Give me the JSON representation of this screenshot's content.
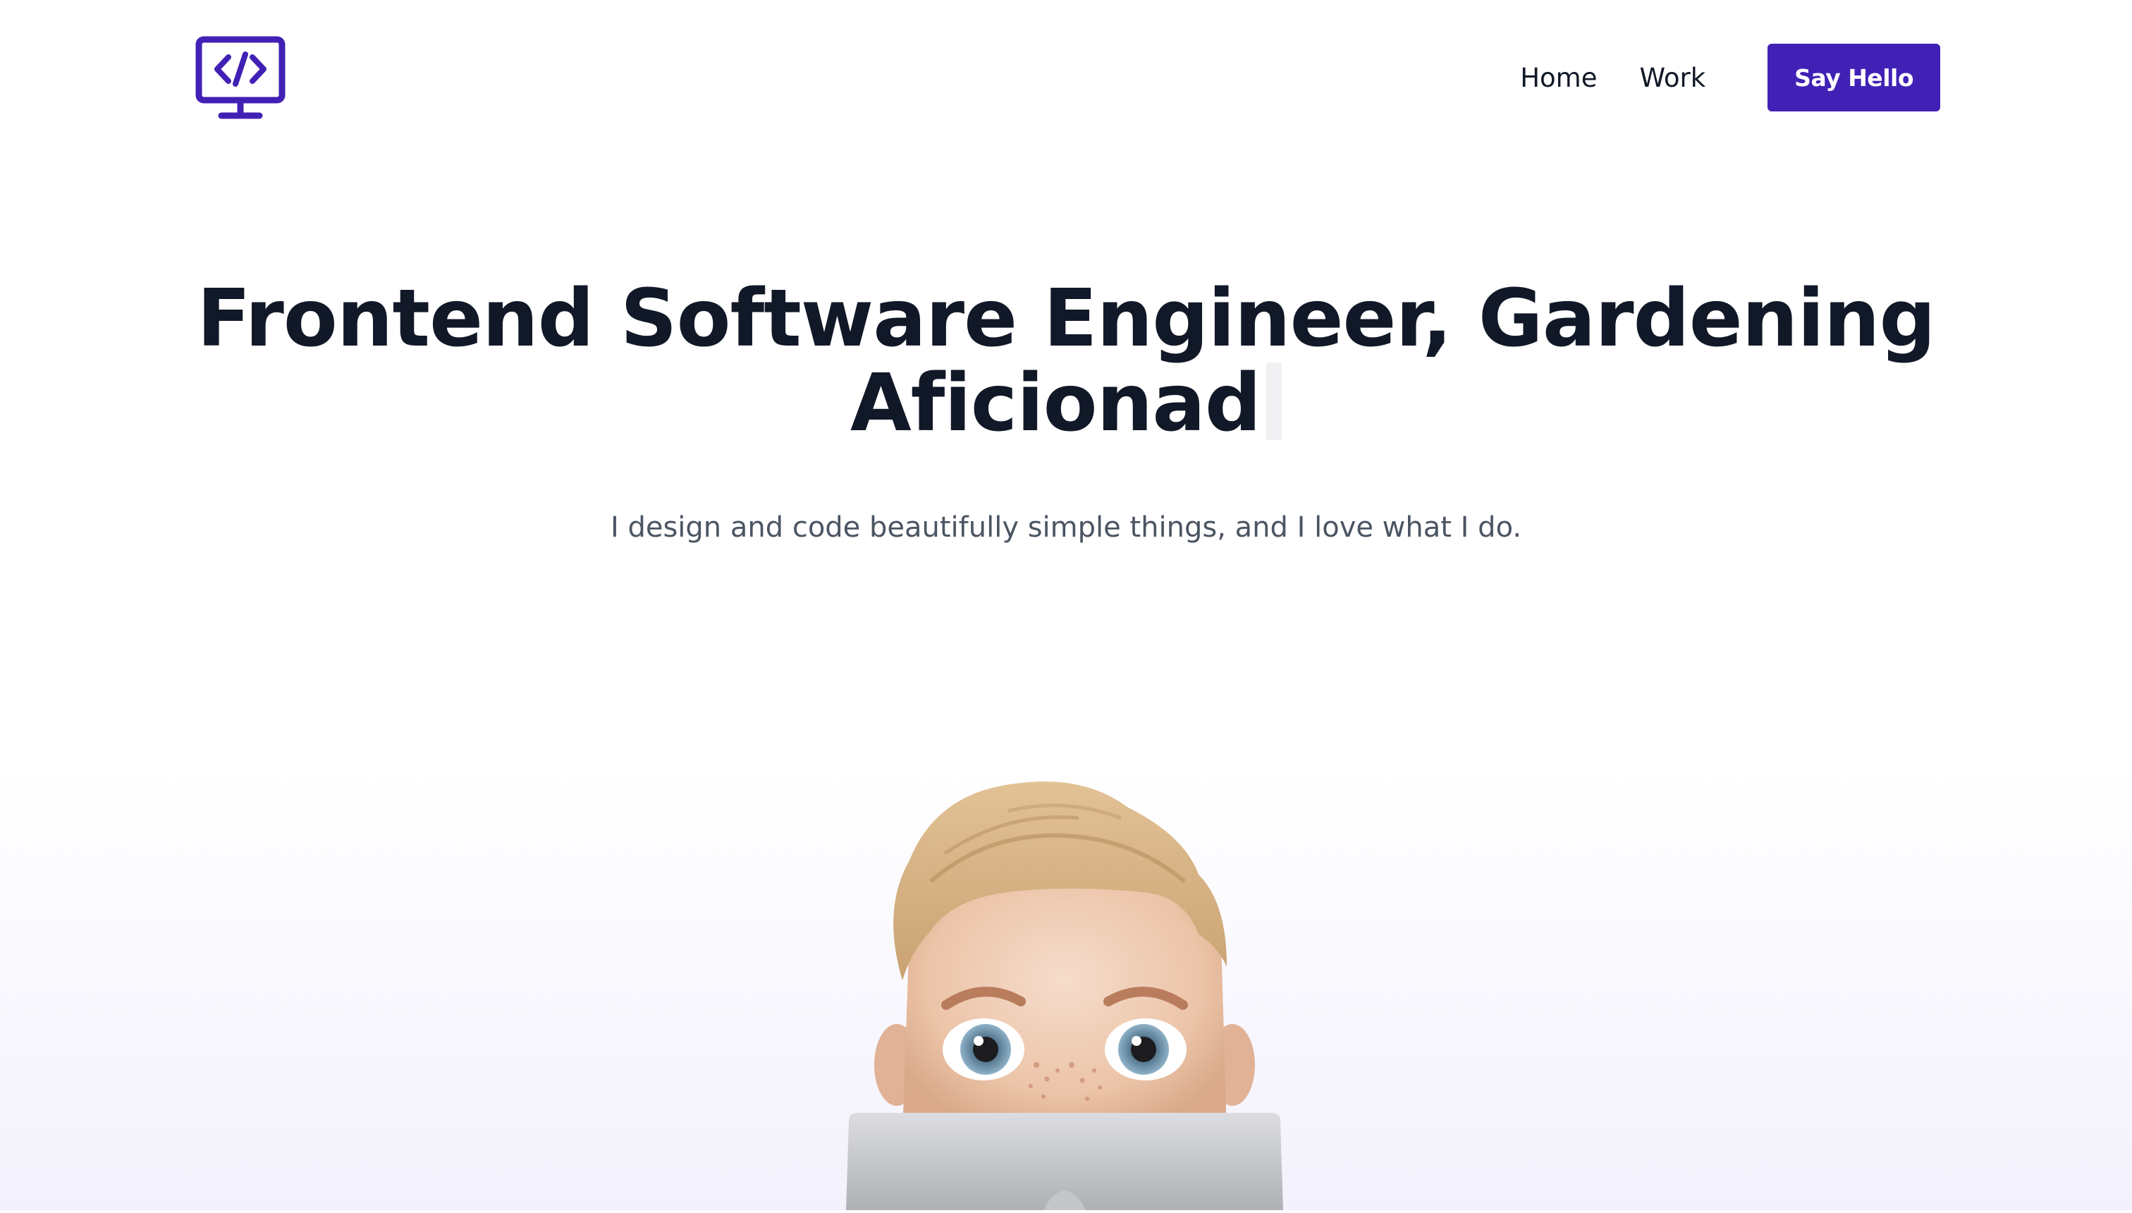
{
  "header": {
    "logo_icon": "monitor-code-icon",
    "nav": [
      {
        "label": "Home"
      },
      {
        "label": "Work"
      }
    ],
    "cta_label": "Say Hello"
  },
  "hero": {
    "title_line1": "Frontend Software Engineer, Gardening",
    "title_line2": "Aficionad",
    "subtitle": "I design and code beautifully simple things, and I love what I do."
  },
  "avatar": {
    "icon": "memoji-laptop-avatar"
  },
  "colors": {
    "accent": "#4121b5",
    "heading": "#111827",
    "body_text": "#4b5563",
    "background": "#ffffff",
    "background_fade": "#f3f1fc"
  }
}
